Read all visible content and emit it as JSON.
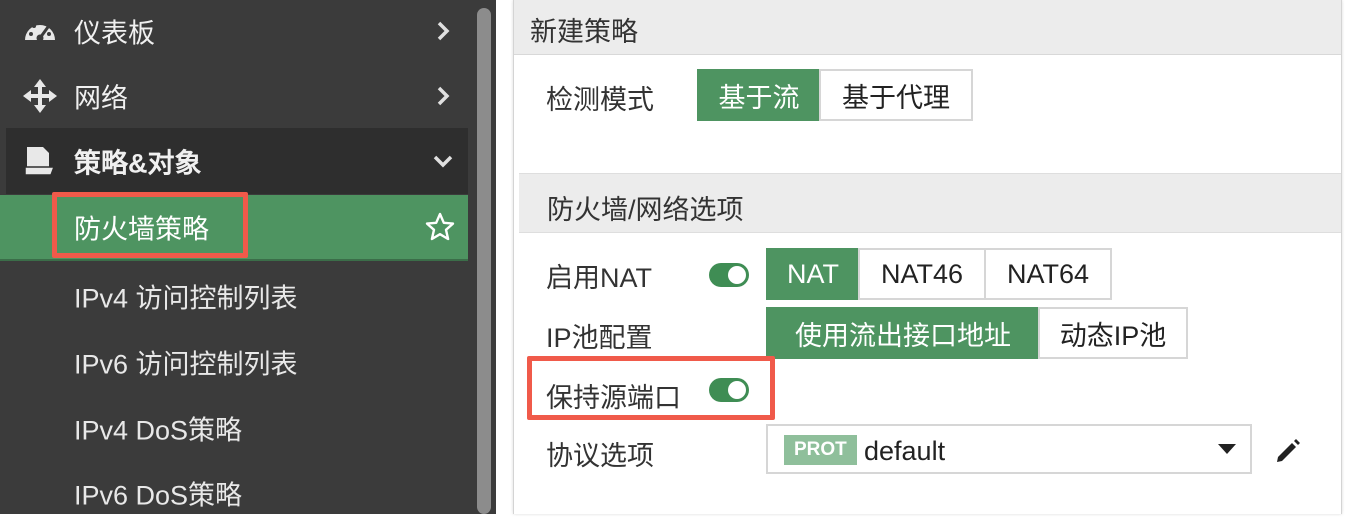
{
  "sidebar": {
    "items": [
      {
        "label": "仪表板",
        "icon": "dashboard-gauge-icon"
      },
      {
        "label": "网络",
        "icon": "move-arrows-icon"
      },
      {
        "label": "策略&对象",
        "icon": "policy-document-icon"
      },
      {
        "label": "防火墙策略",
        "icon": "star-outline-icon"
      },
      {
        "label": "IPv4 访问控制列表"
      },
      {
        "label": "IPv6 访问控制列表"
      },
      {
        "label": "IPv4 DoS策略"
      },
      {
        "label": "IPv6 DoS策略"
      }
    ]
  },
  "panel": {
    "title": "新建策略",
    "inspection_mode": {
      "label": "检测模式",
      "options": [
        "基于流",
        "基于代理"
      ],
      "selected": "基于流"
    },
    "section_title": "防火墙/网络选项",
    "nat": {
      "label": "启用NAT",
      "enabled": true,
      "options": [
        "NAT",
        "NAT46",
        "NAT64"
      ],
      "selected": "NAT"
    },
    "ip_pool": {
      "label": "IP池配置",
      "options": [
        "使用流出接口地址",
        "动态IP池"
      ],
      "selected": "使用流出接口地址"
    },
    "preserve_port": {
      "label": "保持源端口",
      "enabled": true
    },
    "protocol_options": {
      "label": "协议选项",
      "badge": "PROT",
      "value": "default"
    }
  },
  "colors": {
    "accent_green": "#4e9461",
    "highlight_red": "#f05a4a",
    "sidebar_bg": "#3b3b3b"
  }
}
